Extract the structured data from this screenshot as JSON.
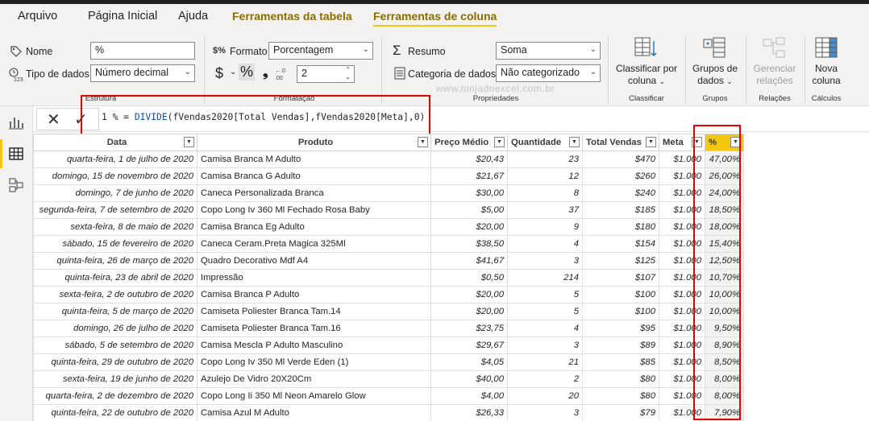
{
  "tabs": [
    {
      "label": "Arquivo"
    },
    {
      "label": "Página Inicial"
    },
    {
      "label": "Ajuda"
    },
    {
      "label": "Ferramentas da tabela"
    },
    {
      "label": "Ferramentas de coluna"
    }
  ],
  "ribbon": {
    "nome_label": "Nome",
    "nome_value": "%",
    "tipo_label": "Tipo de dados",
    "tipo_value": "Número decimal",
    "formato_label": "Formato",
    "formato_value": "Porcentagem",
    "currency_symbol": "$",
    "percent_symbol": "%",
    "comma_symbol": ")",
    "decimals_value": "2",
    "resumo_label": "Resumo",
    "resumo_value": "Soma",
    "categoria_label": "Categoria de dados",
    "categoria_value": "Não categorizado",
    "classificar_label": "Classificar por coluna",
    "grupos_label": "Grupos de dados",
    "gerenciar_label": "Gerenciar relações",
    "nova_label": "Nova coluna",
    "groups": {
      "estrutura": "Estrutura",
      "formatacao": "Formatação",
      "propriedades": "Propriedades",
      "classificar": "Classificar",
      "grupos": "Grupos",
      "relacoes": "Relações",
      "calculos": "Cálculos"
    },
    "watermark": "www.ninjadoexcel.com.br"
  },
  "formula": {
    "line_number": "1",
    "prefix": " % = ",
    "function": "DIVIDE",
    "args": "(fVendas2020[Total Vendas],fVendas2020[Meta],0)"
  },
  "table": {
    "columns": [
      "Data",
      "Produto",
      "Preço Médio",
      "Quantidade",
      "Total Vendas",
      "Meta",
      "%"
    ],
    "rows": [
      [
        "quarta-feira, 1 de julho de 2020",
        "Camisa Branca M Adulto",
        "$20,43",
        "23",
        "$470",
        "$1.000",
        "47,00%"
      ],
      [
        "domingo, 15 de novembro de 2020",
        "Camisa Branca G Adulto",
        "$21,67",
        "12",
        "$260",
        "$1.000",
        "26,00%"
      ],
      [
        "domingo, 7 de junho de 2020",
        "Caneca Personalizada Branca",
        "$30,00",
        "8",
        "$240",
        "$1.000",
        "24,00%"
      ],
      [
        "segunda-feira, 7 de setembro de 2020",
        "Copo Long Iv 360 Ml Fechado Rosa Baby",
        "$5,00",
        "37",
        "$185",
        "$1.000",
        "18,50%"
      ],
      [
        "sexta-feira, 8 de maio de 2020",
        "Camisa Branca Eg Adulto",
        "$20,00",
        "9",
        "$180",
        "$1.000",
        "18,00%"
      ],
      [
        "sábado, 15 de fevereiro de 2020",
        "Caneca Ceram.Preta Magica 325Ml",
        "$38,50",
        "4",
        "$154",
        "$1.000",
        "15,40%"
      ],
      [
        "quinta-feira, 26 de março de 2020",
        "Quadro Decorativo Mdf A4",
        "$41,67",
        "3",
        "$125",
        "$1.000",
        "12,50%"
      ],
      [
        "quinta-feira, 23 de abril de 2020",
        "Impressão",
        "$0,50",
        "214",
        "$107",
        "$1.000",
        "10,70%"
      ],
      [
        "sexta-feira, 2 de outubro de 2020",
        "Camisa Branca P Adulto",
        "$20,00",
        "5",
        "$100",
        "$1.000",
        "10,00%"
      ],
      [
        "quinta-feira, 5 de março de 2020",
        "Camiseta Poliester Branca Tam.14",
        "$20,00",
        "5",
        "$100",
        "$1.000",
        "10,00%"
      ],
      [
        "domingo, 26 de julho de 2020",
        "Camiseta Poliester Branca Tam.16",
        "$23,75",
        "4",
        "$95",
        "$1.000",
        "9,50%"
      ],
      [
        "sábado, 5 de setembro de 2020",
        "Camisa Mescla P Adulto Masculino",
        "$29,67",
        "3",
        "$89",
        "$1.000",
        "8,90%"
      ],
      [
        "quinta-feira, 29 de outubro de 2020",
        "Copo Long Iv 350 Ml Verde Eden (1)",
        "$4,05",
        "21",
        "$85",
        "$1.000",
        "8,50%"
      ],
      [
        "sexta-feira, 19 de junho de 2020",
        "Azulejo De Vidro 20X20Cm",
        "$40,00",
        "2",
        "$80",
        "$1.000",
        "8,00%"
      ],
      [
        "quarta-feira, 2 de dezembro de 2020",
        "Copo Long Ii 350 Ml Neon Amarelo Glow",
        "$4,00",
        "20",
        "$80",
        "$1.000",
        "8,00%"
      ],
      [
        "quinta-feira, 22 de outubro de 2020",
        "Camisa Azul M Adulto",
        "$26,33",
        "3",
        "$79",
        "$1.000",
        "7,90%"
      ]
    ]
  },
  "colors": {
    "accent": "#f2c811",
    "highlight": "#e60000"
  }
}
